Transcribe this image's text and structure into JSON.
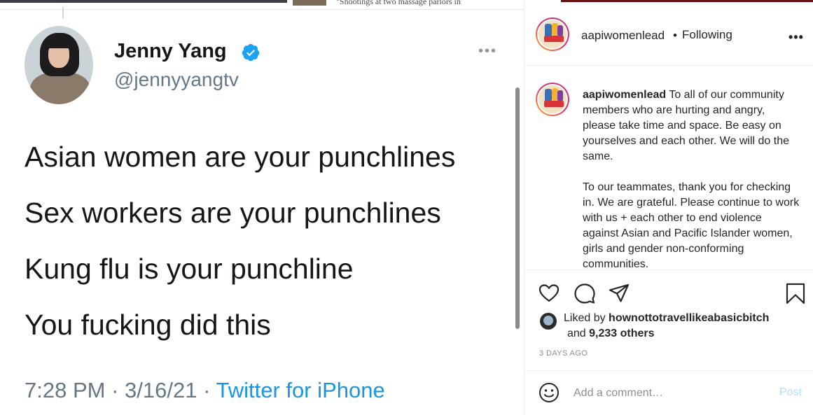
{
  "tweet": {
    "top_headline": "\"Shootings at two massage parlors in",
    "author_name": "Jenny Yang",
    "handle": "@jennyyangtv",
    "lines": [
      "Asian women are your punchlines",
      "Sex workers are your punchlines",
      "Kung flu is your punchline",
      "You fucking did this"
    ],
    "time": "7:28 PM",
    "separator": "·",
    "date": "3/16/21",
    "source": "Twitter for iPhone",
    "colors": {
      "link": "#1b95e0",
      "verified": "#1da1f2"
    }
  },
  "instagram": {
    "header": {
      "username": "aapiwomenlead",
      "dot": "•",
      "following_label": "Following",
      "more_label": "•••"
    },
    "caption": {
      "username": "aapiwomenlead",
      "paragraph1": "To all of our community members who are hurting and angry, please take time and space. Be easy on yourselves and each other. We will do the same.",
      "paragraph2": "To our teammates, thank you for checking in. We are grateful. Please continue to work with us + each other to end violence against Asian and Pacific Islander women, girls and gender non-conforming communities."
    },
    "likes": {
      "prefix": "Liked by",
      "liker": "hownottotravellikeabasicbitch",
      "and_label": "and",
      "others": "9,233 others"
    },
    "timestamp": "3 DAYS AGO",
    "comment": {
      "placeholder": "Add a comment…",
      "post_label": "Post"
    },
    "colors": {
      "post_disabled": "#b2dffc",
      "secondary_text": "#8e8e8e"
    }
  }
}
